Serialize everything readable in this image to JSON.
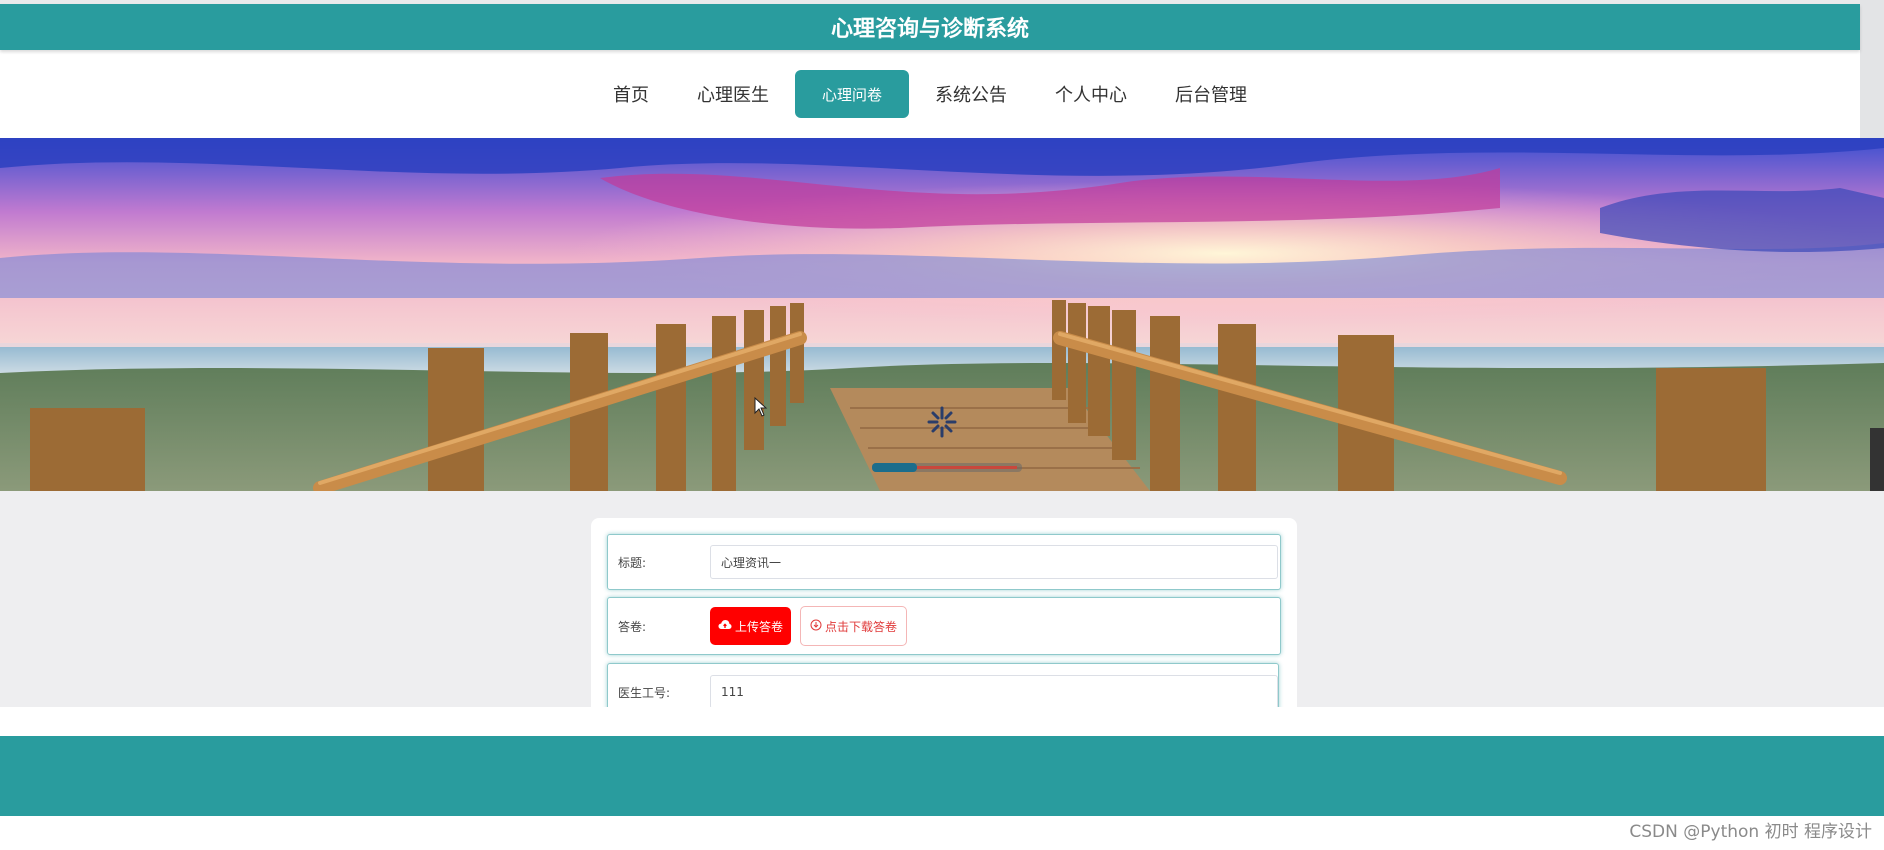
{
  "header": {
    "title": "心理咨询与诊断系统"
  },
  "nav": {
    "items": [
      {
        "label": "首页"
      },
      {
        "label": "心理医生"
      },
      {
        "label": "心理问卷"
      },
      {
        "label": "系统公告"
      },
      {
        "label": "个人中心"
      },
      {
        "label": "后台管理"
      }
    ],
    "active_index": 2
  },
  "form": {
    "title_label": "标题:",
    "title_value": "心理资讯一",
    "answer_label": "答卷:",
    "upload_button": "上传答卷",
    "download_button": "点击下载答卷",
    "doctor_id_label": "医生工号:",
    "doctor_id_value": "111"
  },
  "colors": {
    "primary": "#299c9e",
    "upload": "#ff0000",
    "content_bg": "#eeeef0"
  },
  "watermark": "CSDN @Python 初时 程序设计"
}
